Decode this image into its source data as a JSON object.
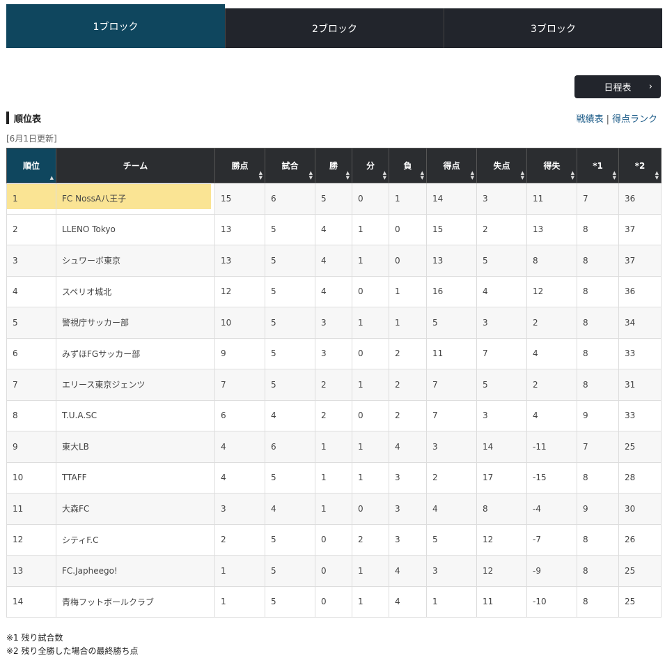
{
  "tabs": [
    {
      "label": "1ブロック",
      "active": true
    },
    {
      "label": "2ブロック",
      "active": false
    },
    {
      "label": "3ブロック",
      "active": false
    }
  ],
  "schedule_button": {
    "label": "日程表",
    "chevron": "›"
  },
  "section": {
    "title": "順位表"
  },
  "links": {
    "record": "戦績表",
    "separator": "|",
    "scorers": "得点ランク"
  },
  "updated": "[6月1日更新]",
  "table": {
    "headers": [
      "順位",
      "チーム",
      "勝点",
      "試合",
      "勝",
      "分",
      "負",
      "得点",
      "失点",
      "得失",
      "*1",
      "*2"
    ],
    "rows": [
      [
        "1",
        "FC NossA八王子",
        "15",
        "6",
        "5",
        "0",
        "1",
        "14",
        "3",
        "11",
        "7",
        "36"
      ],
      [
        "2",
        "LLENO Tokyo",
        "13",
        "5",
        "4",
        "1",
        "0",
        "15",
        "2",
        "13",
        "8",
        "37"
      ],
      [
        "3",
        "シュワーボ東京",
        "13",
        "5",
        "4",
        "1",
        "0",
        "13",
        "5",
        "8",
        "8",
        "37"
      ],
      [
        "4",
        "スペリオ城北",
        "12",
        "5",
        "4",
        "0",
        "1",
        "16",
        "4",
        "12",
        "8",
        "36"
      ],
      [
        "5",
        "警視庁サッカー部",
        "10",
        "5",
        "3",
        "1",
        "1",
        "5",
        "3",
        "2",
        "8",
        "34"
      ],
      [
        "6",
        "みずほFGサッカー部",
        "9",
        "5",
        "3",
        "0",
        "2",
        "11",
        "7",
        "4",
        "8",
        "33"
      ],
      [
        "7",
        "エリース東京ジェンツ",
        "7",
        "5",
        "2",
        "1",
        "2",
        "7",
        "5",
        "2",
        "8",
        "31"
      ],
      [
        "8",
        "T.U.A.SC",
        "6",
        "4",
        "2",
        "0",
        "2",
        "7",
        "3",
        "4",
        "9",
        "33"
      ],
      [
        "9",
        "東大LB",
        "4",
        "6",
        "1",
        "1",
        "4",
        "3",
        "14",
        "-11",
        "7",
        "25"
      ],
      [
        "10",
        "TTAFF",
        "4",
        "5",
        "1",
        "1",
        "3",
        "2",
        "17",
        "-15",
        "8",
        "28"
      ],
      [
        "11",
        "大森FC",
        "3",
        "4",
        "1",
        "0",
        "3",
        "4",
        "8",
        "-4",
        "9",
        "30"
      ],
      [
        "12",
        "シティF.C",
        "2",
        "5",
        "0",
        "2",
        "3",
        "5",
        "12",
        "-7",
        "8",
        "26"
      ],
      [
        "13",
        "FC.Japheego!",
        "1",
        "5",
        "0",
        "1",
        "4",
        "3",
        "12",
        "-9",
        "8",
        "25"
      ],
      [
        "14",
        "青梅フットボールクラブ",
        "1",
        "5",
        "0",
        "1",
        "4",
        "1",
        "11",
        "-10",
        "8",
        "25"
      ]
    ]
  },
  "notes": [
    "※1 残り試合数",
    "※2 残り全勝した場合の最終勝ち点"
  ],
  "colors": {
    "active_tab": "#0f465e",
    "dark": "#22252c",
    "highlight": "#fae38e",
    "link": "#1a5a87"
  },
  "icons": {
    "sort": "sort-arrows-icon",
    "chevron": "chevron-right-icon"
  }
}
